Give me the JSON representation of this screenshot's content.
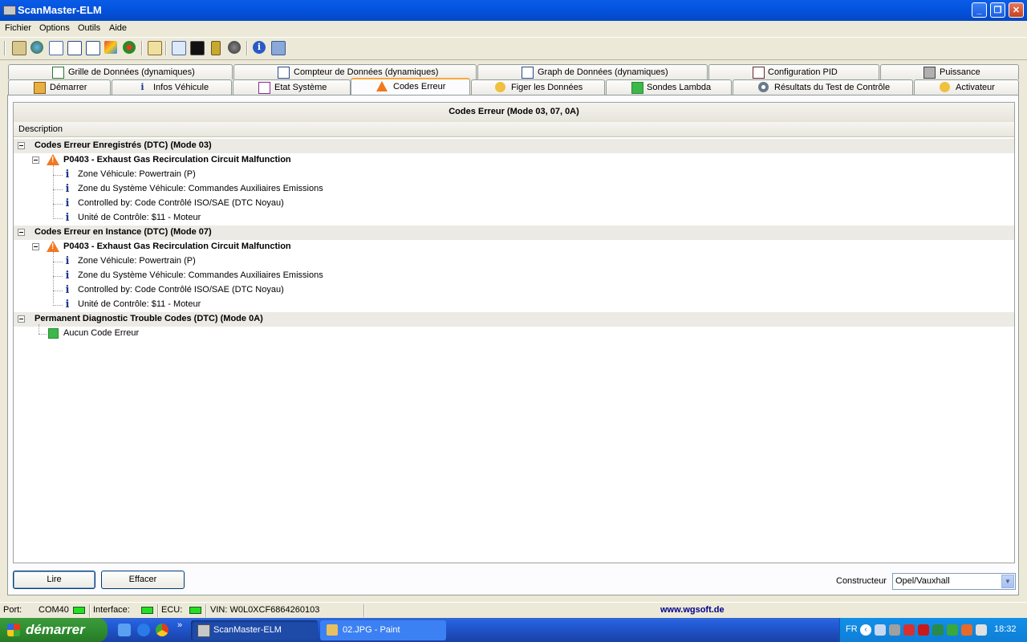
{
  "window": {
    "title": "ScanMaster-ELM",
    "controls": {
      "minimize": "_",
      "maximize": "❐",
      "close": "✕"
    }
  },
  "menu": [
    "Fichier",
    "Options",
    "Outils",
    "Aide"
  ],
  "tabs_top": [
    {
      "label": "Grille de Données (dynamiques)",
      "icon": "grid-icon"
    },
    {
      "label": "Compteur de Données (dynamiques)",
      "icon": "table-icon"
    },
    {
      "label": "Graph de Données (dynamiques)",
      "icon": "graph-icon"
    },
    {
      "label": "Configuration PID",
      "icon": "config-icon"
    },
    {
      "label": "Puissance",
      "icon": "chip-icon"
    }
  ],
  "tabs_bottom": [
    {
      "label": "Démarrer",
      "icon": "home-icon"
    },
    {
      "label": "Infos Véhicule",
      "icon": "info-icon"
    },
    {
      "label": "Etat Système",
      "icon": "checklist-icon"
    },
    {
      "label": "Codes Erreur",
      "icon": "warning-icon",
      "active": true
    },
    {
      "label": "Figer les Données",
      "icon": "hand-icon"
    },
    {
      "label": "Sondes Lambda",
      "icon": "sensor-icon"
    },
    {
      "label": "Résultats du Test de Contrôle",
      "icon": "gear-icon"
    },
    {
      "label": "Activateur",
      "icon": "hand-icon"
    }
  ],
  "grid": {
    "title": "Codes Erreur (Mode 03, 07, 0A)",
    "column": "Description",
    "sections": [
      {
        "title": "Codes Erreur Enregistrés (DTC) (Mode 03)",
        "dtc": "P0403 - Exhaust Gas Recirculation Circuit Malfunction",
        "details": [
          "Zone Véhicule: Powertrain (P)",
          "Zone du Système Véhicule: Commandes Auxiliaires Emissions",
          "Controlled by: Code Contrôlé ISO/SAE (DTC Noyau)",
          "Unité de Contrôle: $11 - Moteur"
        ]
      },
      {
        "title": "Codes Erreur en Instance (DTC) (Mode 07)",
        "dtc": "P0403 - Exhaust Gas Recirculation Circuit Malfunction",
        "details": [
          "Zone Véhicule: Powertrain (P)",
          "Zone du Système Véhicule: Commandes Auxiliaires Emissions",
          "Controlled by: Code Contrôlé ISO/SAE (DTC Noyau)",
          "Unité de Contrôle: $11 - Moteur"
        ]
      },
      {
        "title": "Permanent Diagnostic Trouble Codes (DTC) (Mode 0A)",
        "none": "Aucun Code Erreur"
      }
    ]
  },
  "buttons": {
    "read": "Lire",
    "clear": "Effacer"
  },
  "manufacturer": {
    "label": "Constructeur",
    "value": "Opel/Vauxhall"
  },
  "status": {
    "port_label": "Port:",
    "port_value": "COM40",
    "interface_label": "Interface:",
    "ecu_label": "ECU:",
    "vin": "VIN: W0L0XCF6864260103",
    "website": "www.wgsoft.de",
    "led_color": "#22e022"
  },
  "taskbar": {
    "start": "démarrer",
    "tasks": [
      "ScanMaster-ELM",
      "02.JPG - Paint"
    ],
    "overflow": "»",
    "lang": "FR",
    "clock": "18:32"
  }
}
